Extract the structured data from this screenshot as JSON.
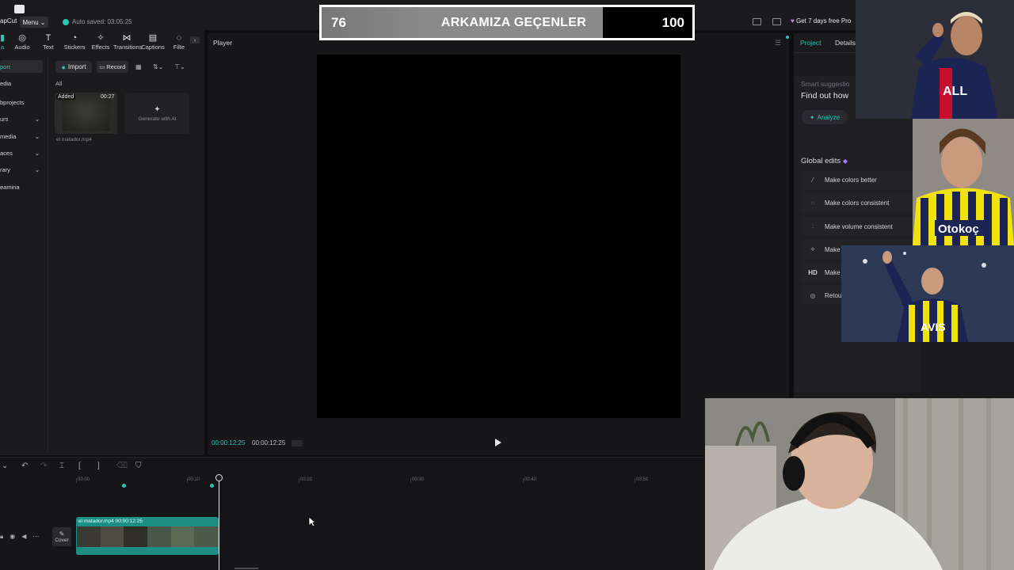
{
  "app": {
    "logo_label": "apCut",
    "menu_label": "Menu",
    "autosave_text": "Auto saved: 03:05:25",
    "pro_label": "Get 7 days free Pro"
  },
  "toolbar": {
    "tabs": [
      {
        "label": "a",
        "icon": "media-icon"
      },
      {
        "label": "Audio",
        "icon": "audio-icon"
      },
      {
        "label": "Text",
        "icon": "text-icon"
      },
      {
        "label": "Stickers",
        "icon": "sticker-icon"
      },
      {
        "label": "Effects",
        "icon": "effects-icon"
      },
      {
        "label": "Transitions",
        "icon": "transitions-icon"
      },
      {
        "label": "Captions",
        "icon": "captions-icon"
      },
      {
        "label": "Filte",
        "icon": "filter-icon"
      }
    ]
  },
  "sidenav": {
    "items": [
      {
        "label": "port",
        "active": true
      },
      {
        "label": "edia",
        "active": false
      },
      {
        "label": "bprojects",
        "active": false
      },
      {
        "label": "urs",
        "active": false
      },
      {
        "label": "media",
        "active": false
      },
      {
        "label": "aces",
        "active": false
      },
      {
        "label": "rary",
        "active": false
      },
      {
        "label": "eamina",
        "active": false
      }
    ]
  },
  "media_panel": {
    "import_label": "Import",
    "record_label": "Record",
    "filter_label": "All",
    "thumb_badge": "Added",
    "thumb_duration": "00:27",
    "thumb_name": "el matador.mp4",
    "generate_label": "Generate with AI"
  },
  "player": {
    "title": "Player",
    "time_current": "00:00:12:25",
    "time_total": "00:00:12:25"
  },
  "right_panel": {
    "tab_project": "Project",
    "tab_details": "Details",
    "smart_suggestions": "Smart suggestio",
    "find_out": "Find out how",
    "analyze_label": "Analyze",
    "global_edits": "Global edits",
    "edits": [
      {
        "label": "Make colors better",
        "icon": "wand-icon"
      },
      {
        "label": "Make colors consistent",
        "icon": "palette-icon"
      },
      {
        "label": "Make volume consistent",
        "icon": "volume-icon"
      },
      {
        "label": "Make",
        "icon": "sparkle-icon"
      },
      {
        "label": "Make",
        "icon": "hd-icon",
        "glyph": "HD"
      },
      {
        "label": "Retou",
        "icon": "retouch-icon"
      }
    ]
  },
  "timeline": {
    "ruler": [
      "00:00",
      "00:10",
      "00:20",
      "00:30",
      "00:40",
      "00:50"
    ],
    "clip_label": "el matador.mp4  00:00:12:25",
    "cover_label": "Cover"
  },
  "overlay": {
    "left_score": "76",
    "title": "ARKAMIZA GEÇENLER",
    "right_score": "100"
  },
  "colors": {
    "accent": "#2bc4b6",
    "panel": "#1b1b1e",
    "clip": "#1d8e84"
  }
}
